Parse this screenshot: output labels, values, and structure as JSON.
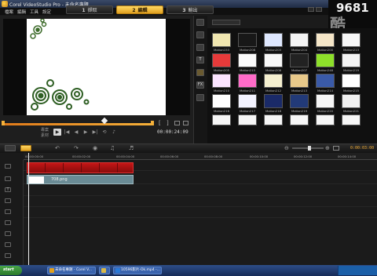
{
  "window": {
    "title": "Corel VideoStudio Pro - 未命名專題"
  },
  "menu": [
    "檔案",
    "編輯",
    "工具",
    "設定"
  ],
  "steps": [
    {
      "num": "1",
      "label": "擷取",
      "active": false
    },
    {
      "num": "2",
      "label": "編輯",
      "active": true
    },
    {
      "num": "3",
      "label": "輸出",
      "active": false
    }
  ],
  "watermark": {
    "number": "9681",
    "char": "酷"
  },
  "player": {
    "labels": [
      "專案",
      "素材"
    ],
    "timecode": "00:00:24:09",
    "scrub_progress": 1.0
  },
  "library": {
    "side_icons": [
      "media-icon",
      "video-icon",
      "photo-icon",
      "title-icon",
      "graphic-icon",
      "fx-icon",
      "filter-icon"
    ],
    "thumbnails": [
      {
        "label": "Motion153"
      },
      {
        "label": "Motion208"
      },
      {
        "label": "Motion203"
      },
      {
        "label": "Motion204"
      },
      {
        "label": "Motion200"
      },
      {
        "label": "Motion213"
      },
      {
        "label": "Motion205"
      },
      {
        "label": "Motion215"
      },
      {
        "label": "Motion208"
      },
      {
        "label": "Motion207"
      },
      {
        "label": "Motion248"
      },
      {
        "label": "Motion219"
      },
      {
        "label": "Motion210"
      },
      {
        "label": "Motion211"
      },
      {
        "label": "Motion212"
      },
      {
        "label": "Motion213"
      },
      {
        "label": "Motion214"
      },
      {
        "label": "Motion215"
      },
      {
        "label": "Motion216"
      },
      {
        "label": "Motion217"
      },
      {
        "label": "Motion218"
      },
      {
        "label": "Motion219"
      },
      {
        "label": "Motion220"
      },
      {
        "label": "Motion221"
      }
    ]
  },
  "timeline": {
    "timecode": "0:00:03:00",
    "ruler": [
      "00:00:00:00",
      "00:00:02:00",
      "00:00:04:00",
      "00:00:06:00",
      "00:00:08:00",
      "00:00:10:00",
      "00:00:12:00",
      "00:00:14:00"
    ],
    "photo_clip": "708.png"
  },
  "taskbar": {
    "start": "start",
    "tasks": [
      "未命名專題 - Corel V...",
      "",
      "10596影片-Ok.mp4 -..."
    ]
  },
  "colors": {
    "accent": "#e0a020",
    "clip_red": "#c41616",
    "clip_photo": "#6a8b95"
  }
}
